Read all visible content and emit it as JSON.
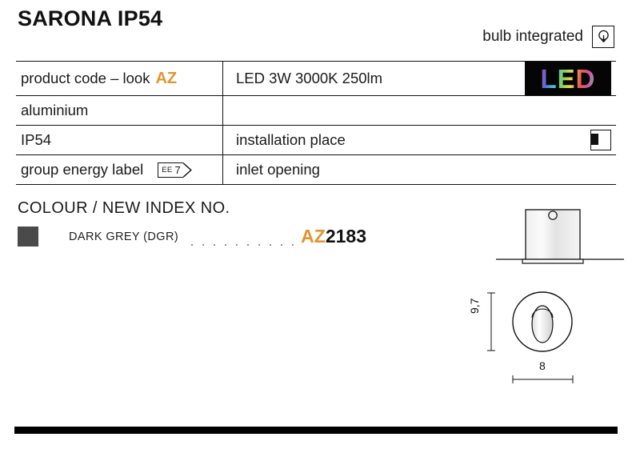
{
  "header": {
    "title": "SARONA IP54",
    "bulb_label": "bulb integrated",
    "bulb_icon": "light-bulb-icon"
  },
  "spec_table": {
    "rows": [
      {
        "left_label": "product code – look",
        "left_accent": "AZ",
        "right_label": "LED 3W 3000K 250lm",
        "right_icon": "led-logo",
        "right_icon_text": "LED"
      },
      {
        "left_label": "aluminium",
        "right_label": ""
      },
      {
        "left_label": "IP54",
        "right_label": "installation place",
        "right_icon": "installation-place-icon"
      },
      {
        "left_label": "group energy label",
        "left_badge": {
          "prefix": "EE",
          "value": "7"
        },
        "right_label": "inlet opening"
      }
    ]
  },
  "colour_section": {
    "heading": "COLOUR / NEW INDEX NO.",
    "items": [
      {
        "swatch_color": "#4a4a4a",
        "name": "DARK GREY (DGR)",
        "index_prefix": "AZ",
        "index_number": "2183"
      }
    ]
  },
  "drawings": {
    "side_view": {
      "name": "side-view-drawing"
    },
    "front_view": {
      "name": "front-view-drawing",
      "dimension_height": "9,7",
      "dimension_width": "8"
    }
  },
  "colors": {
    "accent_orange": "#e0952f",
    "swatch_dark_grey": "#4a4a4a",
    "rule_black": "#111111"
  }
}
